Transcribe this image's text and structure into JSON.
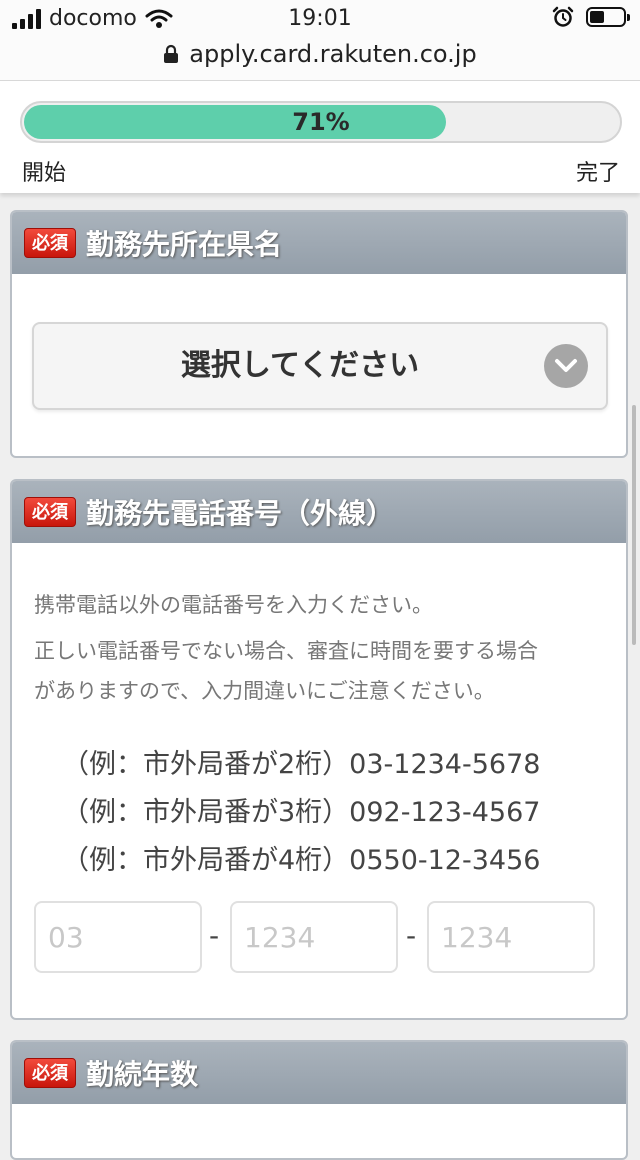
{
  "status_bar": {
    "carrier": "docomo",
    "time": "19:01",
    "battery_level": 0.45
  },
  "browser": {
    "url": "apply.card.rakuten.co.jp"
  },
  "progress": {
    "percent_label": "71%",
    "value": 0.71,
    "start_label": "開始",
    "end_label": "完了",
    "fill_color": "#5ecfab"
  },
  "sections": [
    {
      "badge": "必須",
      "title": "勤務先所在県名",
      "select_label": "選択してください"
    },
    {
      "badge": "必須",
      "title": "勤務先電話番号（外線）",
      "notes": [
        "携帯電話以外の電話番号を入力ください。",
        "正しい電話番号でない場合、審査に時間を要する場合",
        "がありますので、入力間違いにご注意ください。"
      ],
      "examples": [
        "（例：市外局番が2桁）03-1234-5678",
        "（例：市外局番が3桁）092-123-4567",
        "（例：市外局番が4桁）0550-12-3456"
      ],
      "inputs": [
        {
          "placeholder": "03",
          "value": ""
        },
        {
          "placeholder": "1234",
          "value": ""
        },
        {
          "placeholder": "1234",
          "value": ""
        }
      ],
      "separator": "-"
    },
    {
      "badge": "必須",
      "title": "勤続年数"
    }
  ],
  "colors": {
    "header_bg": "#9aa5b0",
    "badge_red": "#d81e12",
    "progress_green": "#5ecfab"
  }
}
